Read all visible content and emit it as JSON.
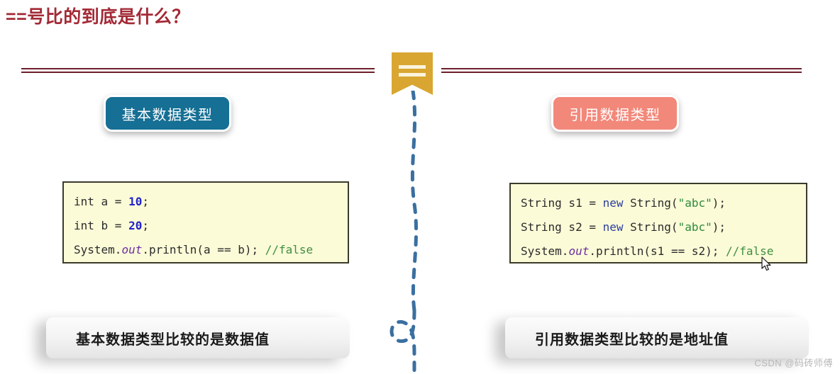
{
  "slide": {
    "title": "==号比的到底是什么？",
    "center_badge": {
      "icon": "equals-banner-icon",
      "symbol": "=="
    },
    "left_column": {
      "label": "基本数据类型",
      "label_color": "#166f94",
      "code": {
        "lines": [
          {
            "parts": [
              {
                "t": "int a = ",
                "k": "plain"
              },
              {
                "t": "10",
                "k": "num"
              },
              {
                "t": ";",
                "k": "plain"
              }
            ]
          },
          {
            "parts": [
              {
                "t": "int b = ",
                "k": "plain"
              },
              {
                "t": "20",
                "k": "num"
              },
              {
                "t": ";",
                "k": "plain"
              }
            ]
          },
          {
            "parts": [
              {
                "t": "System.",
                "k": "plain"
              },
              {
                "t": "out",
                "k": "field"
              },
              {
                "t": ".println(a == b); ",
                "k": "plain"
              },
              {
                "t": "//false",
                "k": "comment"
              }
            ]
          }
        ]
      },
      "conclusion": "基本数据类型比较的是数据值"
    },
    "right_column": {
      "label": "引用数据类型",
      "label_color": "#f2887a",
      "code": {
        "lines": [
          {
            "parts": [
              {
                "t": "String s1 = ",
                "k": "plain"
              },
              {
                "t": "new",
                "k": "keyword"
              },
              {
                "t": " String(",
                "k": "plain"
              },
              {
                "t": "\"abc\"",
                "k": "string"
              },
              {
                "t": ");",
                "k": "plain"
              }
            ]
          },
          {
            "parts": [
              {
                "t": "String s2 = ",
                "k": "plain"
              },
              {
                "t": "new",
                "k": "keyword"
              },
              {
                "t": " String(",
                "k": "plain"
              },
              {
                "t": "\"abc\"",
                "k": "string"
              },
              {
                "t": ");",
                "k": "plain"
              }
            ]
          },
          {
            "parts": [
              {
                "t": "System.",
                "k": "plain"
              },
              {
                "t": "out",
                "k": "field"
              },
              {
                "t": ".println(s1 == s2); ",
                "k": "plain"
              },
              {
                "t": "//false",
                "k": "comment"
              }
            ]
          }
        ]
      },
      "conclusion": "引用数据类型比较的是地址值"
    },
    "watermark": "CSDN @码砖师傅",
    "colors": {
      "title": "#a32a36",
      "divider": "#6d1f2b",
      "banner": "#d9a631",
      "connector": "#3b6fa0",
      "code_bg": "#fbfbd8",
      "code_border": "#3b3b2a"
    }
  }
}
